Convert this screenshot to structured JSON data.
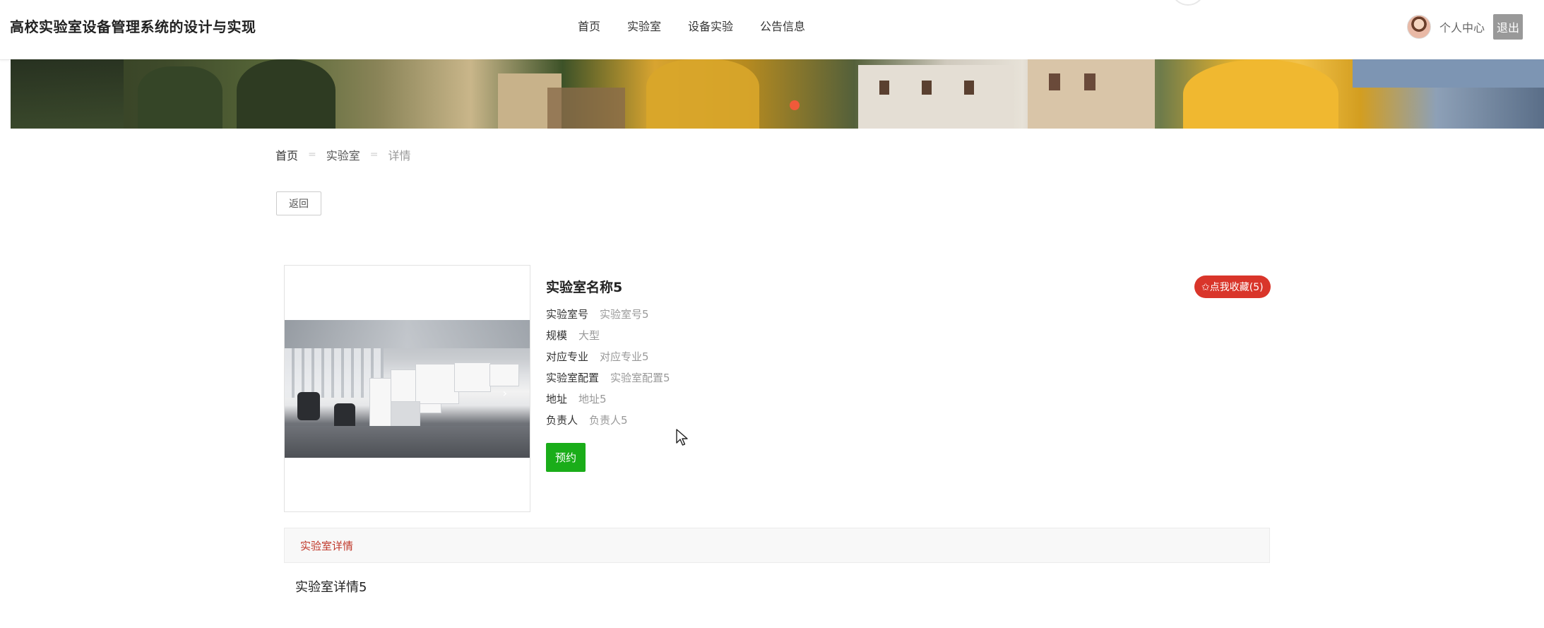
{
  "header": {
    "site_title": "高校实验室设备管理系统的设计与实现",
    "nav": [
      "首页",
      "实验室",
      "设备实验",
      "公告信息"
    ],
    "personal_center": "个人中心",
    "logout": "退出"
  },
  "breadcrumb": {
    "home": "首页",
    "section": "实验室",
    "current": "详情",
    "separator": "="
  },
  "back_button": "返回",
  "detail": {
    "name": "实验室名称5",
    "favorite_label": "✩点我收藏(5)",
    "fields": [
      {
        "key": "实验室号",
        "value": "实验室号5"
      },
      {
        "key": "规模",
        "value": "大型"
      },
      {
        "key": "对应专业",
        "value": "对应专业5"
      },
      {
        "key": "实验室配置",
        "value": "实验室配置5"
      },
      {
        "key": "地址",
        "value": "地址5"
      },
      {
        "key": "负责人",
        "value": "负责人5"
      }
    ],
    "reserve_button": "预约",
    "image_next_arrow": "›"
  },
  "tabs": {
    "active": "实验室详情",
    "content": "实验室详情5"
  },
  "colors": {
    "reserve_green": "#1aad19",
    "favorite_red": "#d9352a",
    "tab_label_red": "#c0392b",
    "banner_dot": "#f05a3a"
  }
}
